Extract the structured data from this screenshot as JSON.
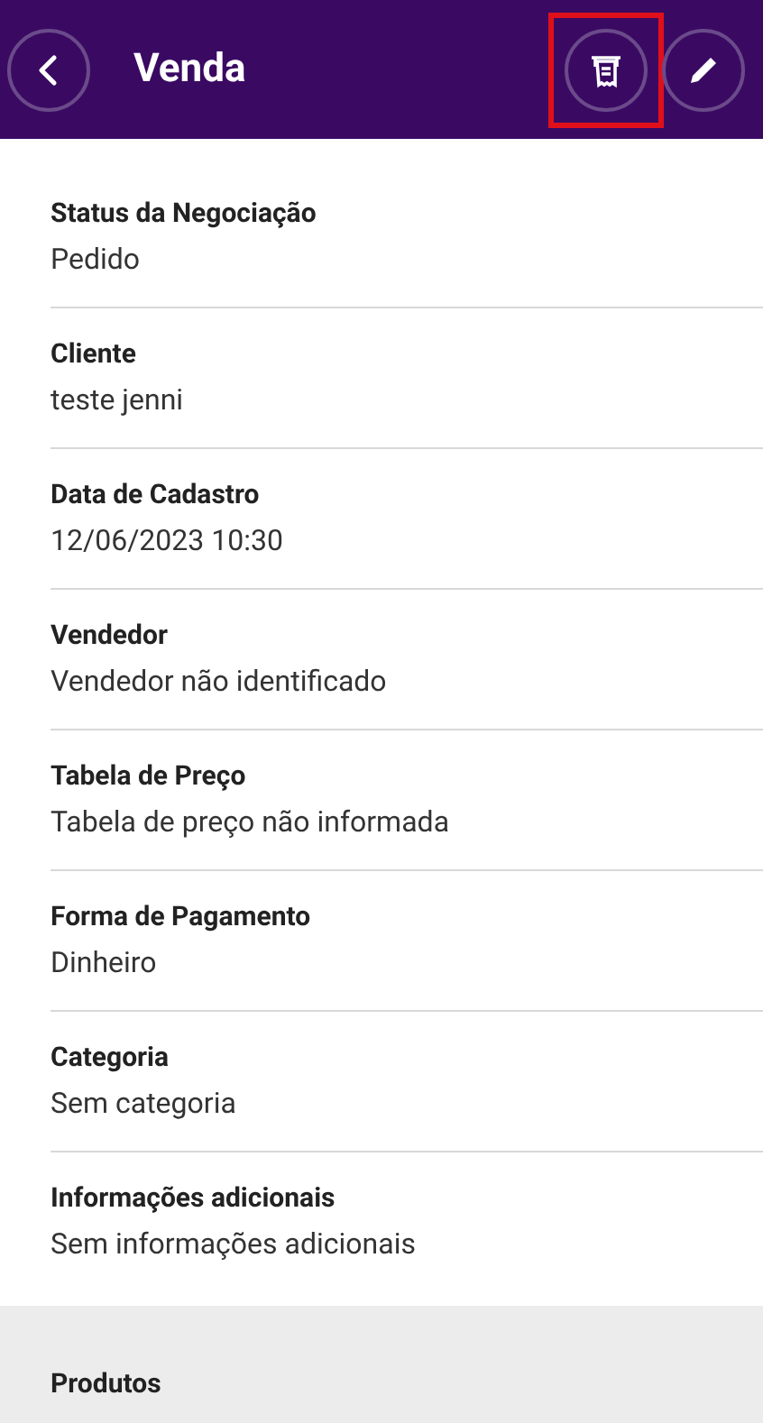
{
  "header": {
    "title": "Venda",
    "actions": [
      {
        "kind": "receipt",
        "highlighted": true
      },
      {
        "kind": "edit",
        "highlighted": false
      }
    ]
  },
  "fields": [
    {
      "label": "Status da Negociação",
      "value": "Pedido"
    },
    {
      "label": "Cliente",
      "value": "teste jenni"
    },
    {
      "label": "Data de Cadastro",
      "value": "12/06/2023 10:30"
    },
    {
      "label": "Vendedor",
      "value": "Vendedor não identificado"
    },
    {
      "label": "Tabela de Preço",
      "value": "Tabela de preço não informada"
    },
    {
      "label": "Forma de Pagamento",
      "value": "Dinheiro"
    },
    {
      "label": "Categoria",
      "value": "Sem categoria"
    },
    {
      "label": "Informações adicionais",
      "value": "Sem informações adicionais"
    }
  ],
  "section": {
    "title": "Produtos"
  }
}
